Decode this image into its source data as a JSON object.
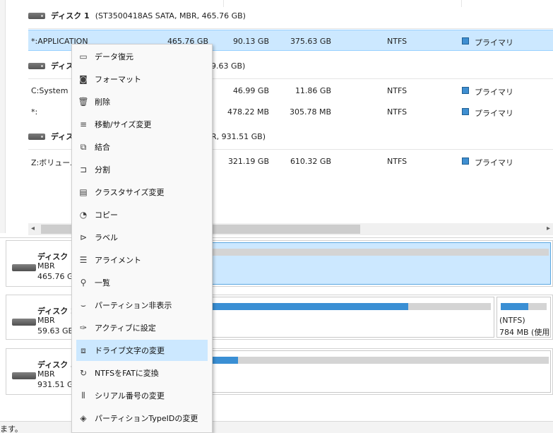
{
  "disks_list": {
    "disk1": {
      "title": "ディスク 1",
      "info": "(ST3500418AS SATA, MBR, 465.76 GB)"
    },
    "disk2": {
      "title": "ディス",
      "info": "9.63 GB)"
    },
    "disk3": {
      "title": "ディス",
      "info": "R, 931.51 GB)"
    },
    "rows": [
      {
        "name": "*:APPLICATION",
        "capacity": "465.76 GB",
        "used": "90.13 GB",
        "free": "375.63 GB",
        "fs": "NTFS",
        "type": "プライマリ"
      },
      {
        "name": "C:System",
        "capacity": "",
        "used": "46.99 GB",
        "free": "11.86 GB",
        "fs": "NTFS",
        "type": "プライマリ"
      },
      {
        "name": "*:",
        "capacity": "",
        "used": "478.22 MB",
        "free": "305.78 MB",
        "fs": "NTFS",
        "type": "プライマリ"
      },
      {
        "name": "Z:ボリューム",
        "capacity": "",
        "used": "321.19 GB",
        "free": "610.32 GB",
        "fs": "NTFS",
        "type": "プライマリ"
      }
    ]
  },
  "scrollbar": {
    "left_arrow": "◂",
    "right_arrow": "▸"
  },
  "disk_map": [
    {
      "title": "ディスク 1",
      "line1": "MBR",
      "line2": "465.76 GB",
      "usage": 0.19
    },
    {
      "title": "ディスク 2",
      "line1": "MBR",
      "line2": "59.63 GB",
      "usage": 0.8,
      "small_part_label": "(NTFS)",
      "small_part_size": "784 MB (使用",
      "small_usage": 0.6
    },
    {
      "title": "ディスク 3",
      "line1": "MBR",
      "line2": "931.51 GB",
      "usage": 0.34
    }
  ],
  "context_menu": {
    "items": [
      {
        "label": "データ復元",
        "icon": "drive-icon"
      },
      {
        "label": "フォーマット",
        "icon": "format-icon"
      },
      {
        "label": "削除",
        "icon": "trash-icon"
      },
      {
        "label": "移動/サイズ変更",
        "icon": "sliders-icon"
      },
      {
        "label": "結合",
        "icon": "merge-icon"
      },
      {
        "label": "分割",
        "icon": "split-icon"
      },
      {
        "label": "クラスタサイズ変更",
        "icon": "cluster-icon"
      },
      {
        "label": "コピー",
        "icon": "copy-icon"
      },
      {
        "label": "ラベル",
        "icon": "label-icon"
      },
      {
        "label": "アライメント",
        "icon": "align-icon"
      },
      {
        "label": "一覧",
        "icon": "magnifier-icon"
      },
      {
        "label": "パーティション非表示",
        "icon": "hidden-eye-icon"
      },
      {
        "label": "アクティブに設定",
        "icon": "pin-icon"
      },
      {
        "label": "ドライブ文字の変更",
        "icon": "drive-letter-icon",
        "highlighted": true
      },
      {
        "label": "NTFSをFATに変換",
        "icon": "convert-icon"
      },
      {
        "label": "シリアル番号の変更",
        "icon": "barcode-icon"
      },
      {
        "label": "パーティションTypeIDの変更",
        "icon": "layers-icon"
      }
    ]
  },
  "status": {
    "text": "ます。"
  },
  "colors": {
    "accent": "#3a8fd4",
    "selection": "#cce8ff"
  }
}
